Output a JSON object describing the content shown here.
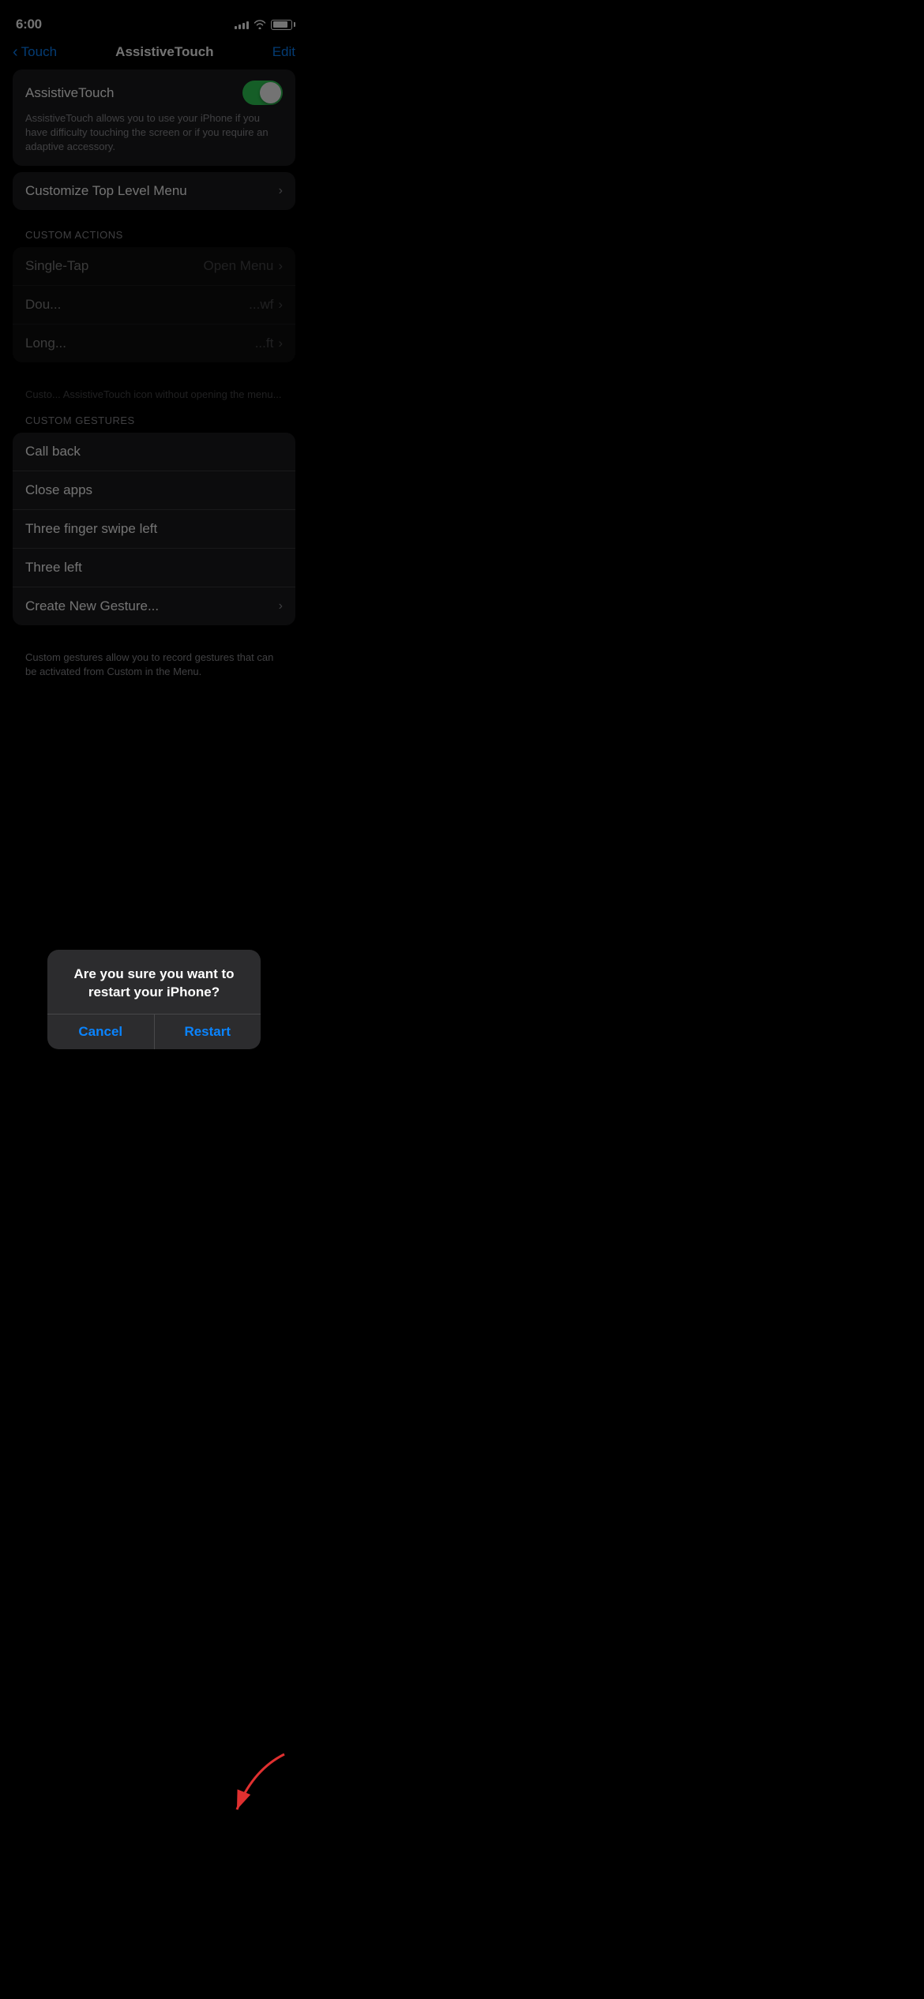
{
  "status_bar": {
    "time": "6:00",
    "signal_bars": [
      3,
      5,
      7,
      9,
      11
    ],
    "wifi": true,
    "battery_level": 85
  },
  "nav": {
    "back_label": "Touch",
    "title": "AssistiveTouch",
    "edit_label": "Edit"
  },
  "toggle_section": {
    "label": "AssistiveTouch",
    "is_on": true,
    "description": "AssistiveTouch allows you to use your iPhone if you have difficulty touching the screen or if you require an adaptive accessory."
  },
  "customize_menu": {
    "label": "Customize Top Level Menu"
  },
  "custom_actions": {
    "section_header": "CUSTOM ACTIONS",
    "items": [
      {
        "label": "Single-Tap",
        "value": "Open Menu"
      },
      {
        "label": "Dou...",
        "value": "...wf"
      },
      {
        "label": "Long...",
        "value": "...ft"
      }
    ],
    "footer": "Custo... AssistiveTouch icon without opening the menu..."
  },
  "custom_gestures": {
    "section_header": "CUSTOM GESTURES",
    "items": [
      {
        "label": "Call back",
        "value": ""
      },
      {
        "label": "Close apps",
        "value": ""
      },
      {
        "label": "Three finger swipe left",
        "value": ""
      },
      {
        "label": "Three left",
        "value": ""
      },
      {
        "label": "Create New Gesture...",
        "value": "chevron"
      }
    ],
    "footer": "Custom gestures allow you to record gestures that can be activated from Custom in the Menu."
  },
  "alert": {
    "title": "Are you sure you want to restart your iPhone?",
    "cancel_label": "Cancel",
    "confirm_label": "Restart"
  }
}
